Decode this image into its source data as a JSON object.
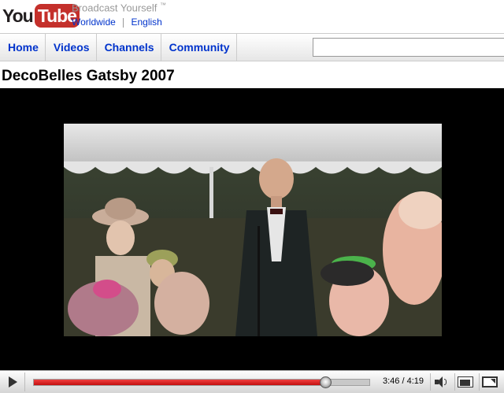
{
  "header": {
    "logo_you": "You",
    "logo_tube": "Tube",
    "tagline": "Broadcast Yourself",
    "tagline_tm": "™",
    "locale_region": "Worldwide",
    "locale_language": "English"
  },
  "nav": {
    "items": [
      {
        "label": "Home"
      },
      {
        "label": "Videos"
      },
      {
        "label": "Channels"
      },
      {
        "label": "Community"
      }
    ],
    "search_value": ""
  },
  "video": {
    "title": "DecoBelles Gatsby 2007"
  },
  "controls": {
    "current_time": "3:46",
    "separator": "/",
    "total_time": "4:19",
    "progress_fraction": 0.87
  },
  "colors": {
    "brand_red": "#c4302b",
    "link_blue": "#0033cc",
    "progress_red": "#d42222"
  }
}
